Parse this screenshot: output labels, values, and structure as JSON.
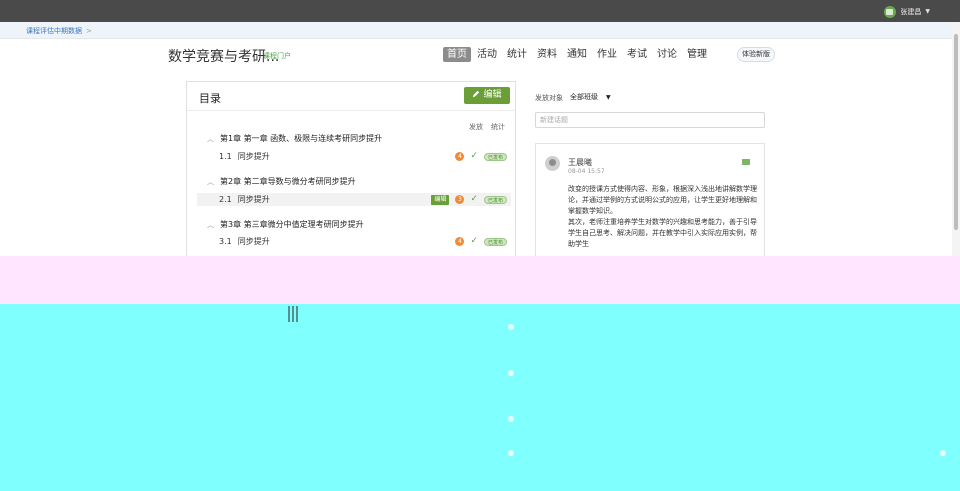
{
  "header": {
    "user_name": "张建昌",
    "breadcrumb": "课程评估中期数据",
    "breadcrumb_sep": ">"
  },
  "course": {
    "title": "数学竞赛与考研...",
    "subtitle": "课程门户"
  },
  "nav": {
    "items": [
      {
        "label": "首页",
        "active": true
      },
      {
        "label": "活动",
        "active": false
      },
      {
        "label": "统计",
        "active": false
      },
      {
        "label": "资料",
        "active": false
      },
      {
        "label": "通知",
        "active": false
      },
      {
        "label": "作业",
        "active": false
      },
      {
        "label": "考试",
        "active": false
      },
      {
        "label": "讨论",
        "active": false
      },
      {
        "label": "管理",
        "active": false
      }
    ],
    "trial_label": "体验新版"
  },
  "toc": {
    "title": "目录",
    "edit_label": "编辑",
    "col_publish": "发放",
    "col_stats": "统计",
    "chapters": [
      {
        "label": "第1章 第一章 函数、极限与连续考研同步提升",
        "sections": [
          {
            "num": "1.1",
            "label": "同步提升",
            "badge": "4",
            "status": "已发布"
          }
        ]
      },
      {
        "label": "第2章 第二章导数与微分考研同步提升",
        "sections": [
          {
            "num": "2.1",
            "label": "同步提升",
            "tag": "编辑",
            "badge": "3",
            "status": "已发布"
          }
        ]
      },
      {
        "label": "第3章 第三章微分中值定理考研同步提升",
        "sections": [
          {
            "num": "3.1",
            "label": "同步提升",
            "badge": "4",
            "status": "已发布"
          }
        ]
      }
    ]
  },
  "discussion": {
    "filter_label": "发放对象",
    "filter_value": "全部班级",
    "input_placeholder": "新建话题",
    "post": {
      "author": "王晨曦",
      "time": "08-04 15:57",
      "body": [
        "改变的授课方式使得内容、形象，根据深入浅出地讲解数学理论，并通过举例的方式说明公式的应用，让学生更好地理解和掌握数学知识。",
        "其次，老师注重培养学生对数学的兴趣和思考能力，善于引导学生自己思考、解决问题，并在教学中引入实际应用实例，帮助学生"
      ]
    }
  },
  "colors": {
    "accent_green": "#6a9f38",
    "badge_orange": "#f08a34",
    "topbar": "#4a4a4a",
    "link_blue": "#3a78c2"
  }
}
